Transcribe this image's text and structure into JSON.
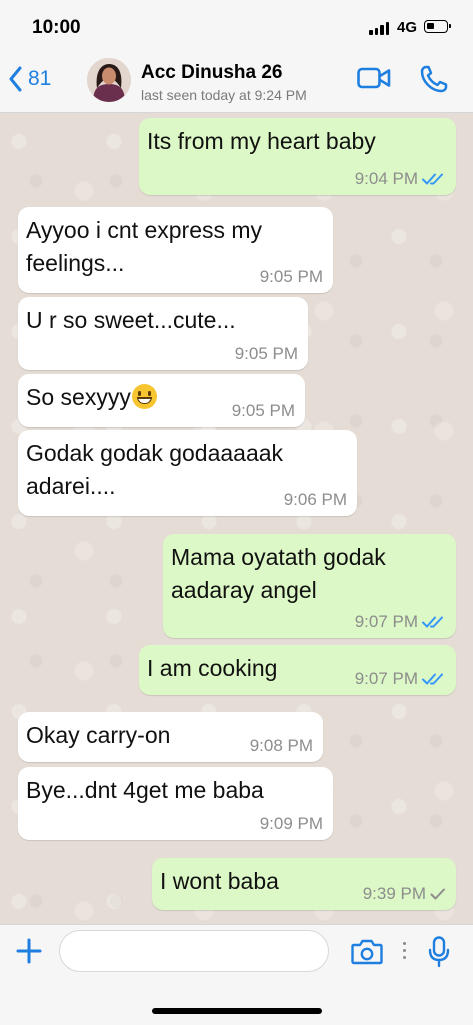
{
  "status_bar": {
    "time": "10:00",
    "network": "4G"
  },
  "header": {
    "back_count": "81",
    "contact_name": "Acc Dinusha 26",
    "last_seen": "last seen today at 9:24 PM"
  },
  "messages": [
    {
      "direction": "out",
      "text": "Its from my heart baby",
      "time": "9:04 PM",
      "status": "read"
    },
    {
      "direction": "in",
      "lines": [
        "Ayyoo i cnt express my",
        "feelings..."
      ],
      "time": "9:05 PM"
    },
    {
      "direction": "in",
      "text": "U r so sweet...cute...",
      "time": "9:05 PM"
    },
    {
      "direction": "in",
      "text": "So sexyyy",
      "emoji": "grinning-face",
      "time": "9:05 PM"
    },
    {
      "direction": "in",
      "lines": [
        "Godak godak godaaaaak",
        "adarei...."
      ],
      "time": "9:06 PM"
    },
    {
      "direction": "out",
      "lines": [
        "Mama oyatath godak",
        "aadaray angel"
      ],
      "time": "9:07 PM",
      "status": "read"
    },
    {
      "direction": "out",
      "text": "I am cooking",
      "time": "9:07 PM",
      "status": "read"
    },
    {
      "direction": "in",
      "text": "Okay carry-on",
      "time": "9:08 PM"
    },
    {
      "direction": "in",
      "text": "Bye...dnt 4get me baba",
      "time": "9:09 PM"
    },
    {
      "direction": "out",
      "text": "I wont baba",
      "time": "9:39 PM",
      "status": "sent"
    }
  ],
  "input": {
    "placeholder": ""
  },
  "colors": {
    "accent": "#1f7fe0",
    "read_tick": "#3497f9",
    "sent_tick": "#8d8d8d",
    "incoming_bubble": "#ffffff",
    "outgoing_bubble": "#dcf8c6",
    "chat_background": "#e5ddd5"
  },
  "icons": {
    "back": "chevron-left-icon",
    "video": "video-camera-icon",
    "call": "phone-icon",
    "plus": "plus-icon",
    "camera": "camera-icon",
    "mic": "microphone-icon"
  }
}
